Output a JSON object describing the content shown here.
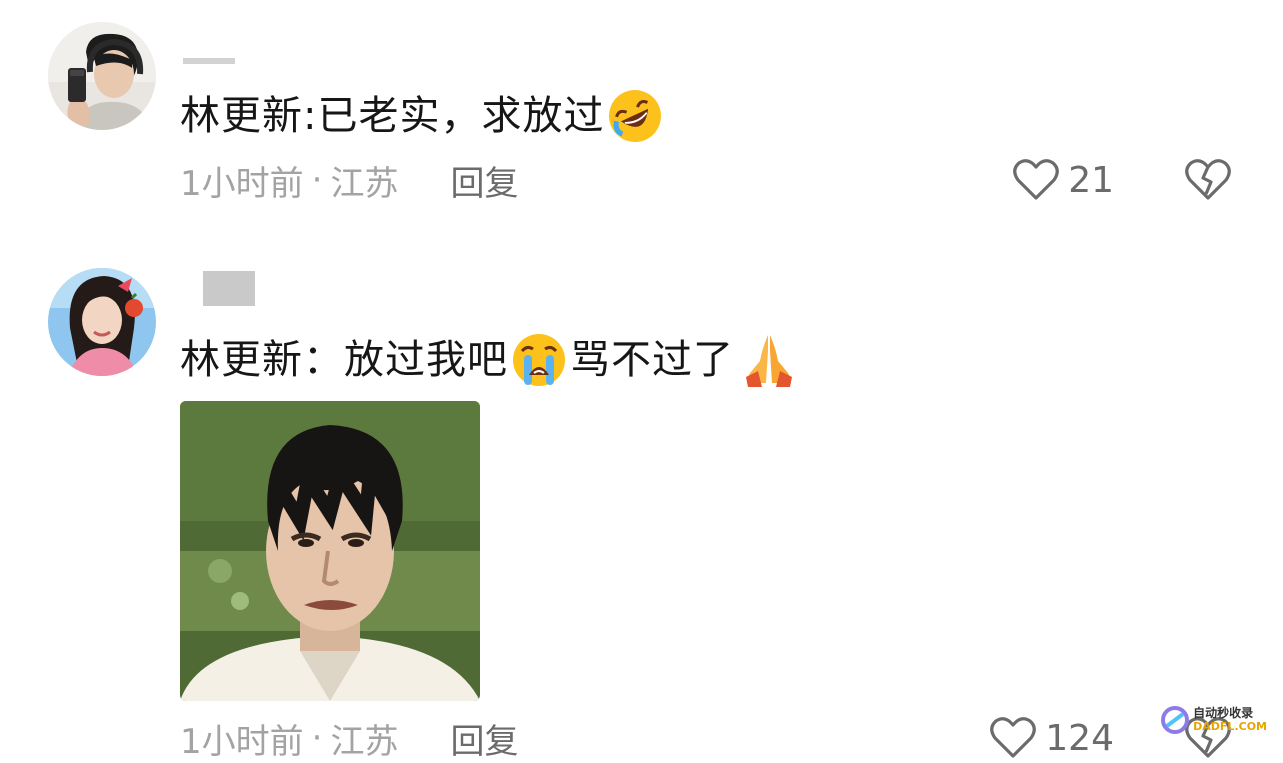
{
  "comments": [
    {
      "avatar": "avatar-boy-selfie",
      "text_before": "林更新:已老实，求放过",
      "emoji": "rolling-laughing-emoji",
      "text_after": "",
      "emoji2": "",
      "time": "1小时前",
      "separator": "·",
      "location": "江苏",
      "reply_label": "回复",
      "likes": "21",
      "like_icon": "heart-outline-icon",
      "dislike_icon": "broken-heart-icon"
    },
    {
      "avatar": "avatar-girl-portrait",
      "text_before": "林更新：放过我吧",
      "emoji": "crying-face-emoji",
      "text_after": "骂不过了",
      "emoji2": "folded-hands-emoji",
      "image": "meme-face-photo",
      "time": "1小时前",
      "separator": "·",
      "location": "江苏",
      "reply_label": "回复",
      "likes": "124",
      "like_icon": "heart-outline-icon",
      "dislike_icon": "broken-heart-icon"
    }
  ],
  "watermark": {
    "top": "自动秒收录",
    "bottom": "DADFL.COM"
  },
  "colors": {
    "text": "#161616",
    "meta": "#a3a3a3",
    "icon": "#6b6b6b"
  }
}
